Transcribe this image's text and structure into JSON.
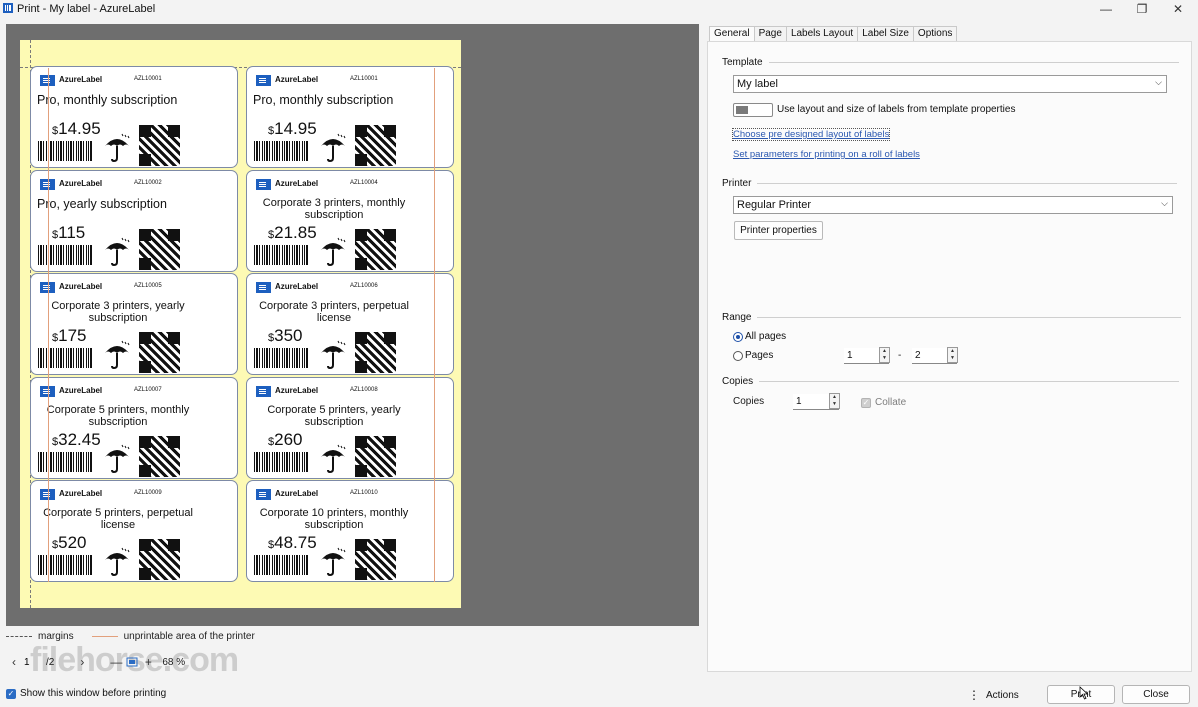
{
  "window": {
    "title": "Print - My label - AzureLabel",
    "minimize_glyph": "—",
    "maximize_glyph": "❐",
    "close_glyph": "✕"
  },
  "labels": [
    {
      "brand": "AzureLabel",
      "code": "AZL10001",
      "title": "Pro, monthly subscription",
      "price": "14.95",
      "big": true
    },
    {
      "brand": "AzureLabel",
      "code": "AZL10001",
      "title": "Pro, monthly subscription",
      "price": "14.95",
      "big": true
    },
    {
      "brand": "AzureLabel",
      "code": "AZL10002",
      "title": "Pro, yearly subscription",
      "price": "115",
      "big": true
    },
    {
      "brand": "AzureLabel",
      "code": "AZL10004",
      "title": "Corporate 3 printers, monthly subscription",
      "price": "21.85",
      "big": false
    },
    {
      "brand": "AzureLabel",
      "code": "AZL10005",
      "title": "Corporate 3 printers, yearly subscription",
      "price": "175",
      "big": false
    },
    {
      "brand": "AzureLabel",
      "code": "AZL10006",
      "title": "Corporate 3 printers, perpetual license",
      "price": "350",
      "big": false
    },
    {
      "brand": "AzureLabel",
      "code": "AZL10007",
      "title": "Corporate 5 printers, monthly subscription",
      "price": "32.45",
      "big": false
    },
    {
      "brand": "AzureLabel",
      "code": "AZL10008",
      "title": "Corporate 5 printers, yearly subscription",
      "price": "260",
      "big": false
    },
    {
      "brand": "AzureLabel",
      "code": "AZL10009",
      "title": "Corporate 5 printers, perpetual license",
      "price": "520",
      "big": false
    },
    {
      "brand": "AzureLabel",
      "code": "AZL10010",
      "title": "Corporate 10 printers, monthly subscription",
      "price": "48.75",
      "big": false
    }
  ],
  "currency_symbol": "$",
  "legend": {
    "margins": "margins",
    "unprintable": "unprintable area of the printer"
  },
  "pager": {
    "prev_glyph": "‹",
    "next_glyph": "›",
    "current_page": "1",
    "total_pages": "/2",
    "zoom_out": "—",
    "zoom_in": "+",
    "zoom_level": "68 %",
    "watermark": "filehorse.com"
  },
  "show_window": {
    "label": "Show this window before printing",
    "checked": true
  },
  "tabs": [
    "General",
    "Page",
    "Labels Layout",
    "Label Size",
    "Options"
  ],
  "template": {
    "heading": "Template",
    "selected": "My label",
    "use_layout_label": "Use layout and size of labels from template properties",
    "choose_link": "Choose pre designed layout of labels",
    "roll_link": "Set parameters for printing on a roll of labels"
  },
  "printer": {
    "heading": "Printer",
    "selected": "Regular Printer",
    "properties_button": "Printer properties"
  },
  "range": {
    "heading": "Range",
    "all_pages": "All pages",
    "pages": "Pages",
    "from": "1",
    "dash": "-",
    "to": "2",
    "selected": "all"
  },
  "copies": {
    "heading": "Copies",
    "label": "Copies",
    "value": "1",
    "collate": "Collate"
  },
  "buttons": {
    "actions": "Actions",
    "print": "Print",
    "close": "Close"
  }
}
